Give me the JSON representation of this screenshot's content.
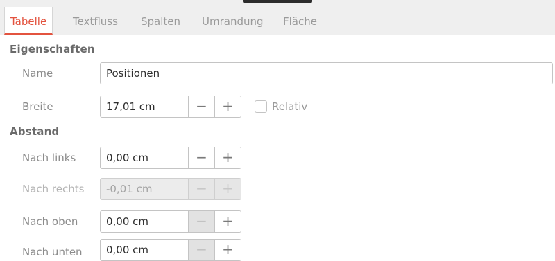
{
  "tabs": [
    {
      "label": "Tabelle",
      "active": true
    },
    {
      "label": "Textfluss",
      "active": false
    },
    {
      "label": "Spalten",
      "active": false
    },
    {
      "label": "Umrandung",
      "active": false
    },
    {
      "label": "Fläche",
      "active": false
    }
  ],
  "colors": {
    "accent": "#e3533f",
    "tab_bg": "#efefef",
    "disabled_bg": "#ececec"
  },
  "properties": {
    "heading": "Eigenschaften",
    "name": {
      "label": "Name",
      "value": "Positionen"
    },
    "width": {
      "label": "Breite",
      "value": "17,01 cm",
      "minus": "−",
      "plus": "+"
    },
    "relative": {
      "label": "Relativ",
      "checked": false
    }
  },
  "spacing": {
    "heading": "Abstand",
    "left": {
      "label": "Nach links",
      "value": "0,00 cm",
      "minus": "−",
      "plus": "+",
      "enabled": true
    },
    "right": {
      "label": "Nach rechts",
      "value": "-0,01 cm",
      "minus": "−",
      "plus": "+",
      "enabled": false
    },
    "top": {
      "label": "Nach oben",
      "value": "0,00 cm",
      "minus": "−",
      "plus": "+",
      "enabled": true
    },
    "bottom": {
      "label": "Nach unten",
      "value": "0,00 cm",
      "minus": "−",
      "plus": "+",
      "enabled": true
    }
  },
  "icons": {
    "minus": "minus-icon",
    "plus": "plus-icon"
  }
}
